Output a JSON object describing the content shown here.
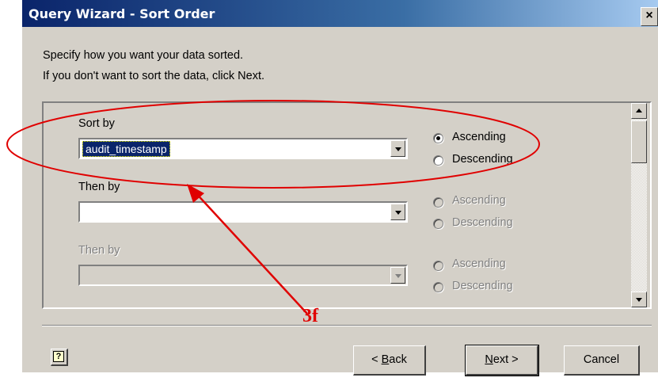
{
  "window": {
    "title": "Query Wizard - Sort Order",
    "close_glyph": "×"
  },
  "instructions": {
    "line1": "Specify how you want your data sorted.",
    "line2": "If you don't want to sort the data, click Next."
  },
  "sort_rows": [
    {
      "label": "Sort by",
      "value": "audit_timestamp",
      "enabled": true,
      "ascending_label": "Ascending",
      "descending_label": "Descending",
      "selected": "Ascending"
    },
    {
      "label": "Then by",
      "value": "",
      "enabled": true,
      "ascending_label": "Ascending",
      "descending_label": "Descending",
      "selected": ""
    },
    {
      "label": "Then by",
      "value": "",
      "enabled": false,
      "ascending_label": "Ascending",
      "descending_label": "Descending",
      "selected": ""
    }
  ],
  "buttons": {
    "back_prefix": "< ",
    "back_hotkey": "B",
    "back_rest": "ack",
    "next_hotkey": "N",
    "next_rest": "ext >",
    "cancel": "Cancel",
    "help_glyph": "?"
  },
  "annotation": {
    "label": "3f",
    "color": "#e00000"
  }
}
